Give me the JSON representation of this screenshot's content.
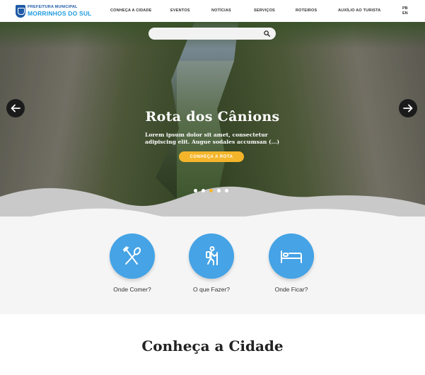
{
  "header": {
    "logo_line1": "PREFEITURA MUNICIPAL",
    "logo_line2": "MORRINHOS DO SUL",
    "nav": [
      "CONHEÇA A CIDADE",
      "EVENTOS",
      "NOTÍCIAS",
      "SERVIÇOS",
      "ROTEIROS",
      "AUXÍLIO AO TURISTA"
    ],
    "languages": [
      "PB",
      "EN"
    ]
  },
  "hero": {
    "search_placeholder": "",
    "title": "Rota dos Cânions",
    "description": "Lorem ipsum dolor sit amet, consectetur adipiscing elit. Augue sodales accumsan (...)",
    "button_label": "CONHEÇA A ROTA",
    "slides_count": 5,
    "active_slide": 3,
    "icons": {
      "search": "search-icon",
      "prev": "arrow-left-icon",
      "next": "arrow-right-icon"
    }
  },
  "services": [
    {
      "label": "Onde Comer?",
      "icon": "fork-spoon-icon"
    },
    {
      "label": "O que Fazer?",
      "icon": "hiker-icon"
    },
    {
      "label": "Onde Ficar?",
      "icon": "bed-icon"
    }
  ],
  "colors": {
    "accent": "#f4b52a",
    "service_blue": "#45a3e6",
    "logo_blue": "#1f5aa6"
  },
  "section": {
    "title": "Conheça a Cidade"
  }
}
